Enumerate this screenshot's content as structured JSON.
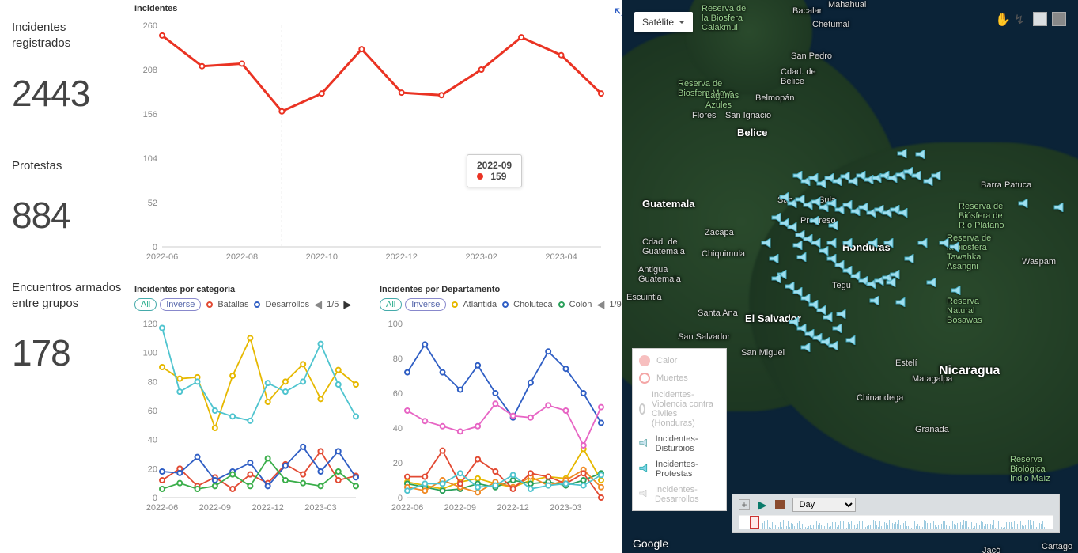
{
  "stats": {
    "label1": "Incidentes registrados",
    "value1": "2443",
    "label2": "Protestas",
    "value2": "884",
    "label3": "Encuentros armados entre grupos",
    "value3": "178"
  },
  "main_chart": {
    "title": "Incidentes",
    "tooltip_date": "2022-09",
    "tooltip_value": "159"
  },
  "cat_chart": {
    "title": "Incidentes por categoría",
    "all": "All",
    "inverse": "Inverse",
    "item1": "Batallas",
    "item2": "Desarrollos",
    "pager": "1/5"
  },
  "dep_chart": {
    "title": "Incidentes por Departamento",
    "all": "All",
    "inverse": "Inverse",
    "item1": "Atlántida",
    "item2": "Choluteca",
    "item3": "Colón",
    "pager": "1/9"
  },
  "map": {
    "satellite": "Satélite",
    "day": "Day"
  },
  "map_legend": {
    "calor": "Calor",
    "muertes": "Muertes",
    "civiles": "Incidentes-Violencia contra Civiles (Honduras)",
    "disturbios": "Incidentes-Disturbios",
    "protestas": "Incidentes-Protestas",
    "desarrollos": "Incidentes-Desarrollos"
  },
  "map_labels": {
    "biosfera": "Reserva de\nla Biosfera\nCalakmul",
    "chetumal": "Chetumal",
    "bacalar": "Bacalar",
    "mahahual": "Mahahual",
    "sanpedro": "San Pedro",
    "maya": "Reserva de\nBiosfera Maya",
    "belize": "Belice",
    "belmopan": "Belmopán",
    "sanignacio": "San Ignacio",
    "flores": "Flores",
    "azules": "Lagunas\nAzules",
    "guatemala": "Guatemala",
    "zacapa": "Zacapa",
    "chiquimula": "Chiquimula",
    "cguate": "Cdad. de\nGuatemala",
    "antigua": "Antigua\nGuatemala",
    "escuintla": "Escuintla",
    "santaana": "Santa Ana",
    "elsalvador": "El Salvador",
    "sansalv": "San Salvador",
    "sanmiguel": "San Miguel",
    "honduras": "Honduras",
    "sula": "Sula",
    "san": "San",
    "progreso": "Progreso",
    "tegu": "Tegu",
    "cbelize": "Cdad. de\nBelice",
    "barra": "Barra Patuca",
    "platano": "Reserva de\nBiósfera de\nRío Plátano",
    "tawahka": "Reserva de\nla biosfera\nTawahka\nAsangni",
    "waspam": "Waspam",
    "bosawas": "Reserva\nNatural\nBosawas",
    "nicaragua": "Nicaragua",
    "esteli": "Estelí",
    "matagalpa": "Matagalpa",
    "chinandega": "Chinandega",
    "granada": "Granada",
    "indiomaiz": "Reserva\nBiológica\nIndio Maíz",
    "cartago": "Cartago",
    "jaco": "Jacó"
  },
  "google": "Google",
  "chart_data": [
    {
      "type": "line",
      "title": "Incidentes",
      "xlabel": "",
      "ylabel": "",
      "x": [
        "2022-06",
        "2022-07",
        "2022-08",
        "2022-09",
        "2022-10",
        "2022-11",
        "2022-12",
        "2023-01",
        "2023-02",
        "2023-03",
        "2023-04",
        "2023-05"
      ],
      "y": [
        248,
        212,
        215,
        159,
        180,
        232,
        181,
        178,
        208,
        246,
        225,
        180
      ],
      "ylim": [
        0,
        260
      ],
      "xticks": [
        "2022-06",
        "2022-08",
        "2022-10",
        "2022-12",
        "2023-02",
        "2023-04"
      ],
      "highlight": {
        "x": "2022-09",
        "y": 159
      }
    },
    {
      "type": "line",
      "title": "Incidentes por categoría",
      "x": [
        "2022-06",
        "2022-07",
        "2022-08",
        "2022-09",
        "2022-10",
        "2022-11",
        "2022-12",
        "2023-01",
        "2023-02",
        "2023-03",
        "2023-04",
        "2023-05"
      ],
      "series": [
        {
          "name": "Batallas",
          "color": "#e24a33",
          "values": [
            12,
            20,
            8,
            14,
            6,
            16,
            10,
            23,
            16,
            32,
            12,
            15
          ]
        },
        {
          "name": "Desarrollos",
          "color": "#2f5ec4",
          "values": [
            18,
            17,
            28,
            12,
            18,
            24,
            8,
            22,
            35,
            18,
            32,
            14
          ]
        },
        {
          "name": "(serie amarilla)",
          "color": "#e6b800",
          "values": [
            90,
            82,
            83,
            48,
            84,
            110,
            66,
            80,
            92,
            68,
            88,
            78
          ]
        },
        {
          "name": "(serie cian)",
          "color": "#4fc4cf",
          "values": [
            117,
            73,
            80,
            60,
            56,
            53,
            79,
            73,
            80,
            106,
            78,
            56
          ]
        },
        {
          "name": "(serie verde)",
          "color": "#3aae4a",
          "values": [
            6,
            10,
            6,
            8,
            16,
            8,
            27,
            12,
            10,
            8,
            18,
            8
          ]
        }
      ],
      "ylim": [
        0,
        120
      ],
      "xticks": [
        "2022-06",
        "2022-09",
        "2022-12",
        "2023-03"
      ]
    },
    {
      "type": "line",
      "title": "Incidentes por Departamento",
      "x": [
        "2022-06",
        "2022-07",
        "2022-08",
        "2022-09",
        "2022-10",
        "2022-11",
        "2022-12",
        "2023-01",
        "2023-02",
        "2023-03",
        "2023-04",
        "2023-05"
      ],
      "series": [
        {
          "name": "Atlántida",
          "color": "#e6b800",
          "values": [
            9,
            7,
            5,
            9,
            11,
            8,
            6,
            10,
            12,
            11,
            28,
            10
          ]
        },
        {
          "name": "Choluteca",
          "color": "#2f5ec4",
          "values": [
            72,
            88,
            72,
            62,
            76,
            60,
            46,
            66,
            84,
            74,
            60,
            43
          ]
        },
        {
          "name": "Colón",
          "color": "#2aa05a",
          "values": [
            8,
            6,
            4,
            5,
            8,
            6,
            10,
            8,
            9,
            7,
            10,
            14
          ]
        },
        {
          "name": "(serie magenta)",
          "color": "#e765c4",
          "values": [
            50,
            44,
            41,
            38,
            41,
            54,
            47,
            46,
            53,
            50,
            30,
            52
          ]
        },
        {
          "name": "(serie naranja)",
          "color": "#f08a24",
          "values": [
            6,
            4,
            10,
            6,
            3,
            9,
            6,
            12,
            7,
            10,
            16,
            6
          ]
        },
        {
          "name": "(serie roja)",
          "color": "#e24a33",
          "values": [
            12,
            12,
            27,
            8,
            22,
            15,
            5,
            14,
            12,
            8,
            14,
            0
          ]
        },
        {
          "name": "(serie cian)",
          "color": "#4fc4cf",
          "values": [
            4,
            8,
            8,
            14,
            6,
            7,
            13,
            5,
            7,
            8,
            7,
            13
          ]
        }
      ],
      "ylim": [
        0,
        100
      ],
      "xticks": [
        "2022-06",
        "2022-09",
        "2022-12",
        "2023-03"
      ]
    }
  ]
}
